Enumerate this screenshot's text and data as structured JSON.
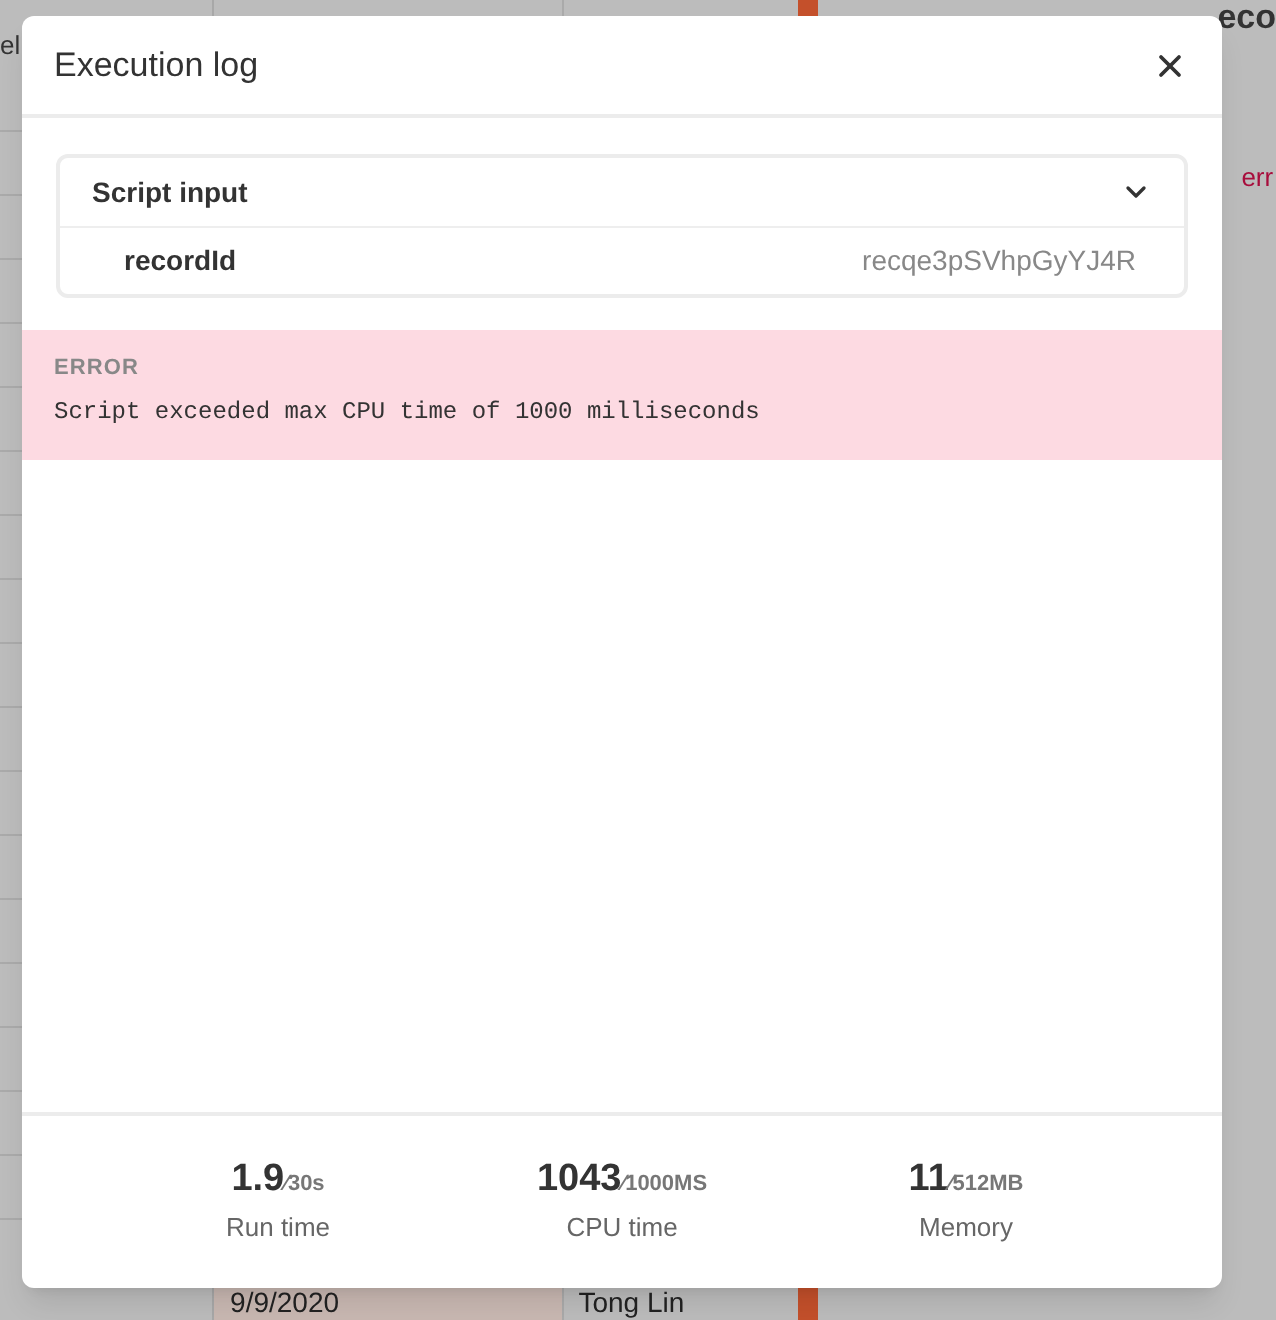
{
  "background": {
    "left_cell": "el",
    "panel_title": "eco",
    "panel_error": "err",
    "bottom_cells": [
      "9/9/2020",
      "Tong Lin"
    ]
  },
  "modal": {
    "title": "Execution log",
    "script_input": {
      "label": "Script input",
      "expanded": true,
      "rows": [
        {
          "key": "recordId",
          "value": "recqe3pSVhpGyYJ4R"
        }
      ]
    },
    "error": {
      "label": "ERROR",
      "message": "Script exceeded max CPU time of 1000 milliseconds"
    },
    "stats": [
      {
        "value": "1.9",
        "limit": "⁄30s",
        "label": "Run time"
      },
      {
        "value": "1043",
        "limit": "⁄1000MS",
        "label": "CPU time"
      },
      {
        "value": "11",
        "limit": "⁄512MB",
        "label": "Memory"
      }
    ]
  }
}
